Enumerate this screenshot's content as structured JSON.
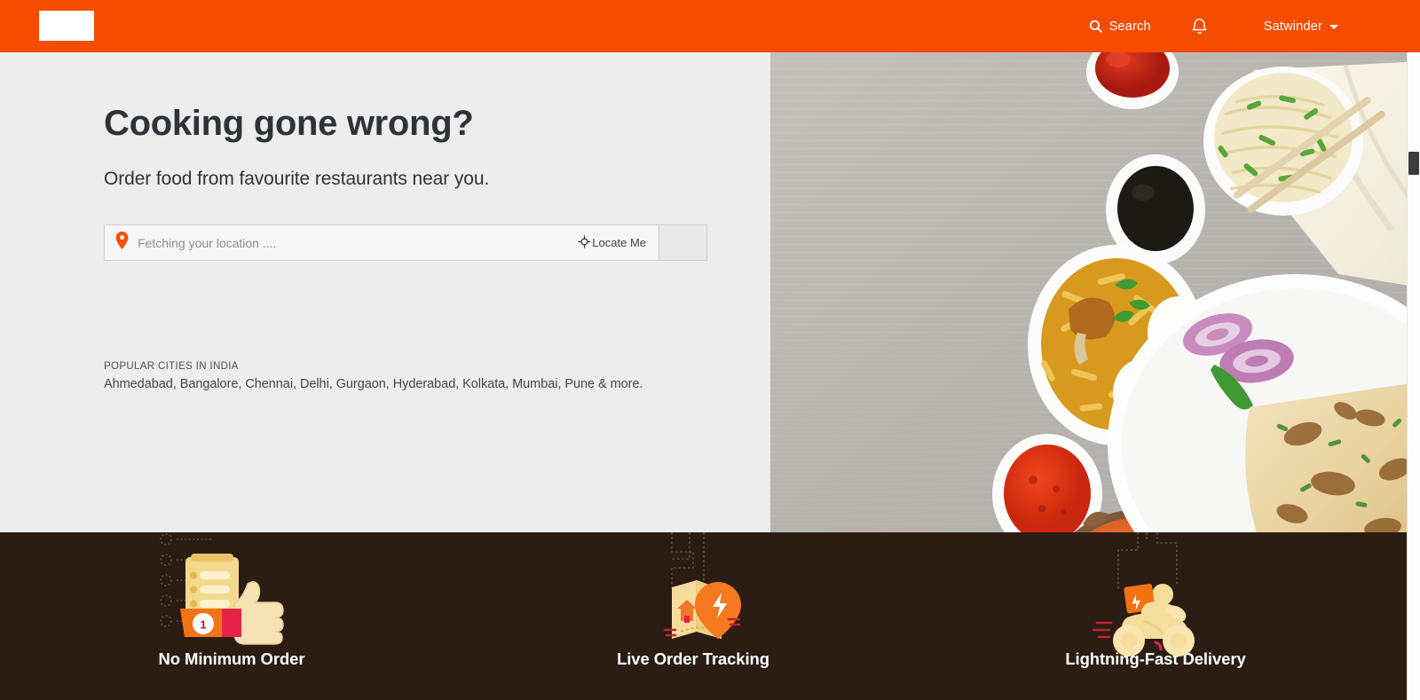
{
  "header": {
    "logo_alt": "brand-logo",
    "search_label": "Search",
    "notifications_label": "",
    "user_name": "Satwinder",
    "brand_color": "#f64c00"
  },
  "hero": {
    "title": "Cooking gone wrong?",
    "subtitle": "Order food from favourite restaurants near you.",
    "location": {
      "placeholder": "Fetching your location ....",
      "value": "",
      "locate_label": "Locate Me",
      "submit_label": ""
    },
    "popular": {
      "heading": "POPULAR CITIES IN INDIA",
      "cities_text": "Ahmedabad, Bangalore, Chennai, Delhi, Gurgaon, Hyderabad, Kolkata, Mumbai, Pune & more.",
      "cities": [
        "Ahmedabad",
        "Bangalore",
        "Chennai",
        "Delhi",
        "Gurgaon",
        "Hyderabad",
        "Kolkata",
        "Mumbai",
        "Pune"
      ]
    },
    "background_color": "#ededed",
    "photo_alt": "indian-food-flatlay-photo"
  },
  "features": {
    "background_color": "#2b1d14",
    "items": [
      {
        "label": "No Minimum Order",
        "icon": "clipboard-thumbsup-icon",
        "badge": "1"
      },
      {
        "label": "Live Order Tracking",
        "icon": "map-pin-icon",
        "badge": ""
      },
      {
        "label": "Lightning-Fast Delivery",
        "icon": "delivery-scooter-icon",
        "badge": ""
      }
    ]
  }
}
